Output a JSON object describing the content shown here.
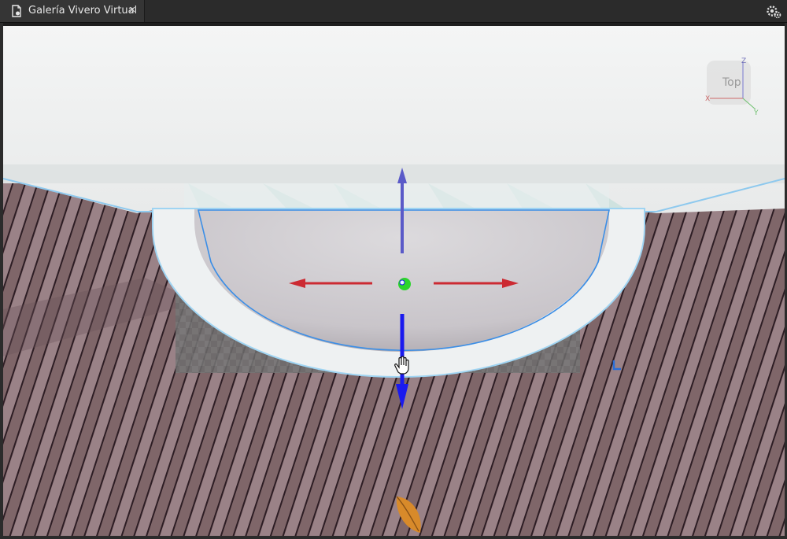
{
  "tab": {
    "title": "Galería Vivero Virtual",
    "close_glyph": "×"
  },
  "viewcube": {
    "face_label": "Top",
    "axis_x": "X",
    "axis_y": "Y",
    "axis_z": "Z"
  },
  "colors": {
    "x_axis": "#cc2a32",
    "y_axis": "#5a5ac8",
    "z_axis": "#1a1aee",
    "center_handle": "#2bd42b",
    "selection_outline": "#3b8ee6",
    "floor": "#8c7378"
  },
  "icons": [
    "document-icon",
    "close-icon",
    "settings-gear-icon",
    "pan-hand-cursor-icon",
    "move-arrow-icon",
    "pivot-handle-icon"
  ]
}
